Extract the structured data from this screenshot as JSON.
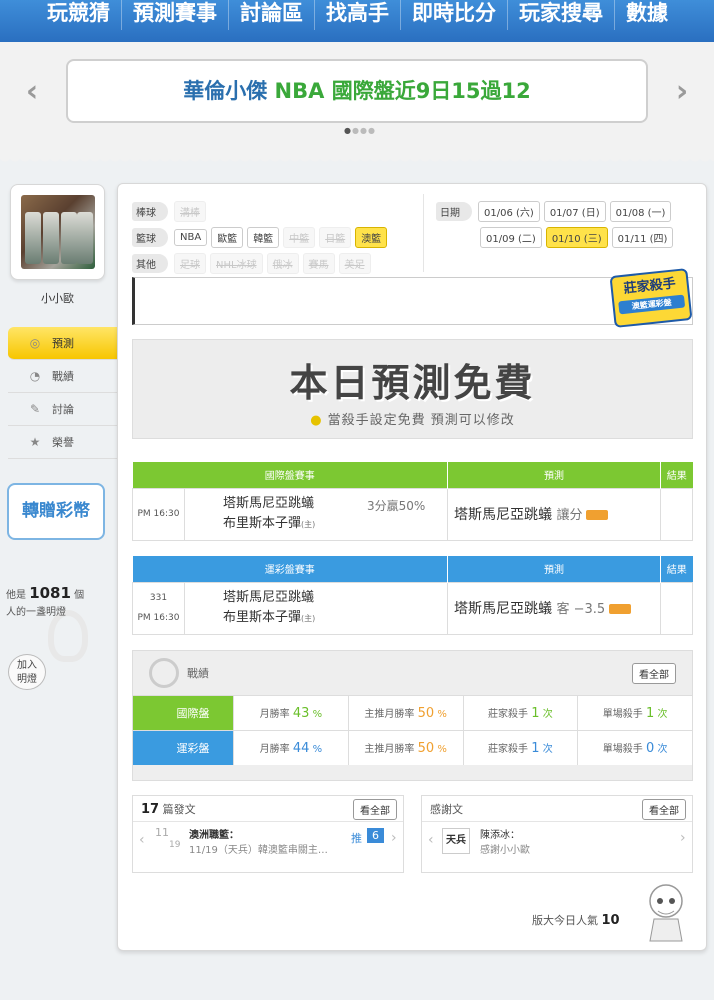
{
  "nav": {
    "items": [
      "玩競猜",
      "預測賽事",
      "討論區",
      "找高手",
      "即時比分",
      "玩家搜尋",
      "數據"
    ]
  },
  "banner": {
    "name": "華倫小傑",
    "text": "NBA 國際盤近9日15過12",
    "prev": "‹",
    "next": "›"
  },
  "user": {
    "name": "小小歐"
  },
  "side_menu": [
    {
      "label": "預測",
      "icon": "◎"
    },
    {
      "label": "戰績",
      "icon": "◔"
    },
    {
      "label": "討論",
      "icon": "✎"
    },
    {
      "label": "榮譽",
      "icon": "★"
    }
  ],
  "gift_button": "轉贈彩幣",
  "fans": {
    "prefix": "他是",
    "count": "1081",
    "suffix1": "個",
    "suffix2": "人的一盞明燈"
  },
  "join": {
    "line1": "加入",
    "line2": "明燈"
  },
  "filters": {
    "baseball": {
      "label": "棒球",
      "tags": [
        {
          "t": "溝棒",
          "s": "dis"
        }
      ]
    },
    "basketball": {
      "label": "籃球",
      "tags": [
        {
          "t": "NBA",
          "s": ""
        },
        {
          "t": "歐籃",
          "s": ""
        },
        {
          "t": "韓籃",
          "s": ""
        },
        {
          "t": "中籃",
          "s": "dis"
        },
        {
          "t": "日籃",
          "s": "dis"
        },
        {
          "t": "澳籃",
          "s": "sel"
        }
      ]
    },
    "other": {
      "label": "其他",
      "tags": [
        {
          "t": "足球",
          "s": "dis"
        },
        {
          "t": "NHL冰球",
          "s": "dis"
        },
        {
          "t": "俄冰",
          "s": "dis"
        },
        {
          "t": "賽馬",
          "s": "dis"
        },
        {
          "t": "美足",
          "s": "dis"
        }
      ]
    }
  },
  "dates": {
    "label": "日期",
    "row1": [
      {
        "t": "01/06 (六)",
        "s": ""
      },
      {
        "t": "01/07 (日)",
        "s": ""
      },
      {
        "t": "01/08 (一)",
        "s": ""
      }
    ],
    "row2": [
      {
        "t": "01/09 (二)",
        "s": ""
      },
      {
        "t": "01/10 (三)",
        "s": "sel"
      },
      {
        "t": "01/11 (四)",
        "s": ""
      }
    ]
  },
  "ad": {
    "title": "莊家殺手",
    "sub": "澳籃運彩盤"
  },
  "free": {
    "title": "本日預測免費",
    "subtitle": "當殺手設定免費 預測可以修改"
  },
  "intl_table": {
    "headers": [
      "國際盤賽事",
      "預測",
      "結果"
    ],
    "time": "PM 16:30",
    "team1": "塔斯馬尼亞跳蟻",
    "team2": "布里斯本子彈",
    "home": "(主)",
    "odds": "3分贏50%",
    "prediction": "塔斯馬尼亞跳蟻",
    "pred_type": "讓分"
  },
  "lottery_table": {
    "headers": [
      "運彩盤賽事",
      "預測",
      "結果"
    ],
    "code": "331",
    "time": "PM 16:30",
    "team1": "塔斯馬尼亞跳蟻",
    "team2": "布里斯本子彈",
    "home": "(主)",
    "prediction": "塔斯馬尼亞跳蟻",
    "pred_type": "客 −3.5"
  },
  "stats": {
    "title": "戰績",
    "see_all": "看全部",
    "rows": [
      {
        "label": "國際盤",
        "color": "#7cc832",
        "c1": "月勝率",
        "v1": "43",
        "u1": "%",
        "c2": "主推月勝率",
        "v2": "50",
        "u2": "%",
        "c3": "莊家殺手",
        "v3": "1",
        "u3": "次",
        "c4": "單場殺手",
        "v4": "1",
        "u4": "次"
      },
      {
        "label": "運彩盤",
        "color": "#3a9be0",
        "c1": "月勝率",
        "v1": "44",
        "u1": "%",
        "c2": "主推月勝率",
        "v2": "50",
        "u2": "%",
        "c3": "莊家殺手",
        "v3": "1",
        "u3": "次",
        "c4": "單場殺手",
        "v4": "0",
        "u4": "次"
      }
    ]
  },
  "posts": {
    "count": "17",
    "label": "篇發文",
    "see_all": "看全部",
    "date_top": "11",
    "date_bottom": "19",
    "title": "澳洲職籃：",
    "excerpt": "11/19（天兵）韓澳籃串關主…",
    "push": "推",
    "push_count": "6"
  },
  "thanks": {
    "label": "感謝文",
    "see_all": "看全部",
    "logo": "天兵",
    "author": "陳添冰：",
    "text": "感謝小小歐"
  },
  "popularity": {
    "label": "版大今日人氣",
    "value": "10"
  },
  "colors": {
    "nav": "#2f7ccc",
    "green": "#7cc832",
    "blue": "#3a9be0",
    "yellow": "#f7c600"
  }
}
